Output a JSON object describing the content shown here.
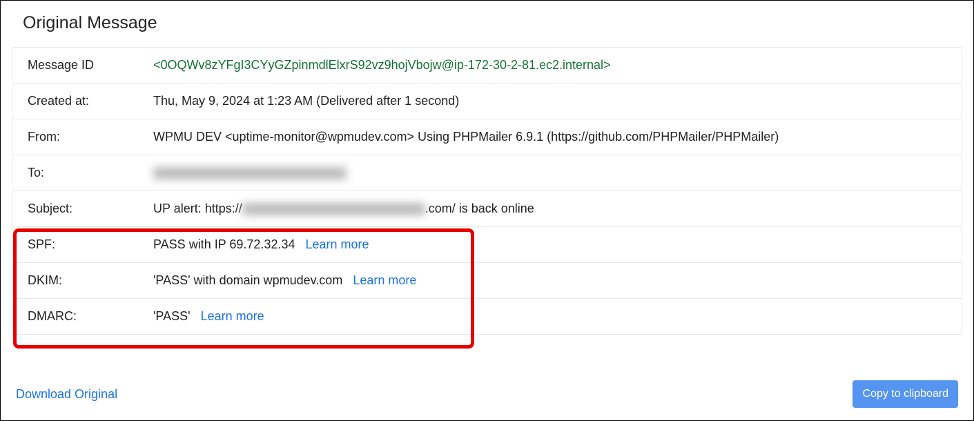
{
  "title": "Original Message",
  "rows": {
    "messageId": {
      "label": "Message ID",
      "value": "<0OQWv8zYFgI3CYyGZpinmdlElxrS92vz9hojVbojw@ip-172-30-2-81.ec2.internal>"
    },
    "createdAt": {
      "label": "Created at:",
      "value": "Thu, May 9, 2024 at 1:23 AM (Delivered after 1 second)"
    },
    "from": {
      "label": "From:",
      "value": "WPMU DEV <uptime-monitor@wpmudev.com> Using PHPMailer 6.9.1 (https://github.com/PHPMailer/PHPMailer)"
    },
    "to": {
      "label": "To:",
      "value": ""
    },
    "subject": {
      "label": "Subject:",
      "prefix": "UP alert: https://",
      "suffix": ".com/ is back online"
    },
    "spf": {
      "label": "SPF:",
      "value": "PASS with IP 69.72.32.34",
      "learnMore": "Learn more"
    },
    "dkim": {
      "label": "DKIM:",
      "value": "'PASS' with domain wpmudev.com",
      "learnMore": "Learn more"
    },
    "dmarc": {
      "label": "DMARC:",
      "value": "'PASS'",
      "learnMore": "Learn more"
    }
  },
  "actions": {
    "download": "Download Original",
    "copy": "Copy to clipboard"
  }
}
